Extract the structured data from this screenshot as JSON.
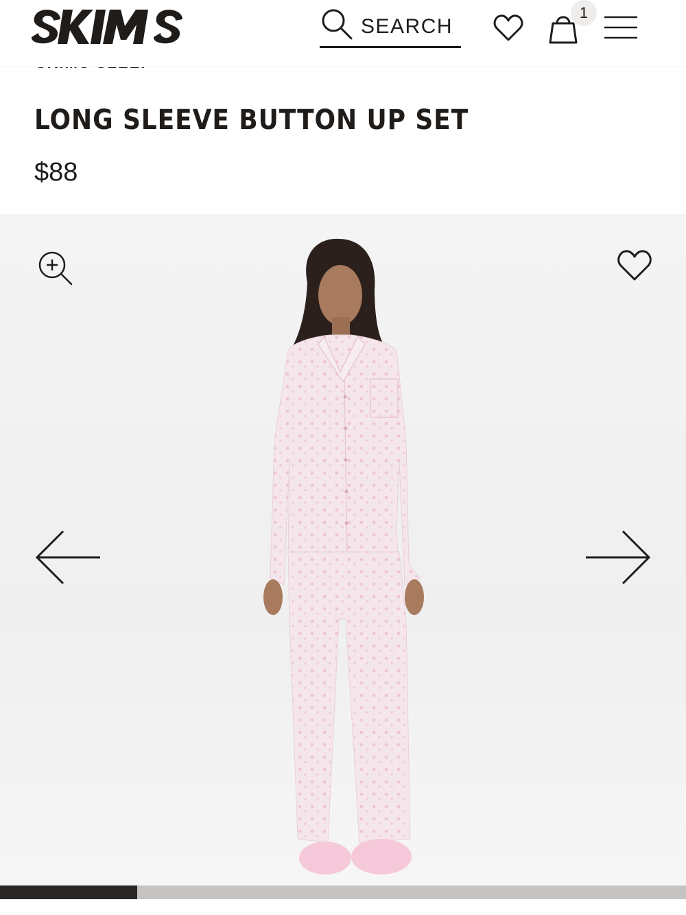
{
  "header": {
    "brand": "SKIMS",
    "search_label": "SEARCH",
    "cart_count": "1"
  },
  "product": {
    "collection": "SKIMS SLEEP",
    "title": "LONG SLEEVE BUTTON UP SET",
    "price": "$88"
  },
  "gallery": {
    "image_count": 5,
    "current_index": 1,
    "progress_fraction": 0.2
  },
  "colors": {
    "ink": "#1f1c1a",
    "gallery_bg": "#f2f2f2",
    "pajama_pink": "#f3dde6",
    "progress_active": "#2a2624",
    "progress_track": "#c6c4c2"
  }
}
